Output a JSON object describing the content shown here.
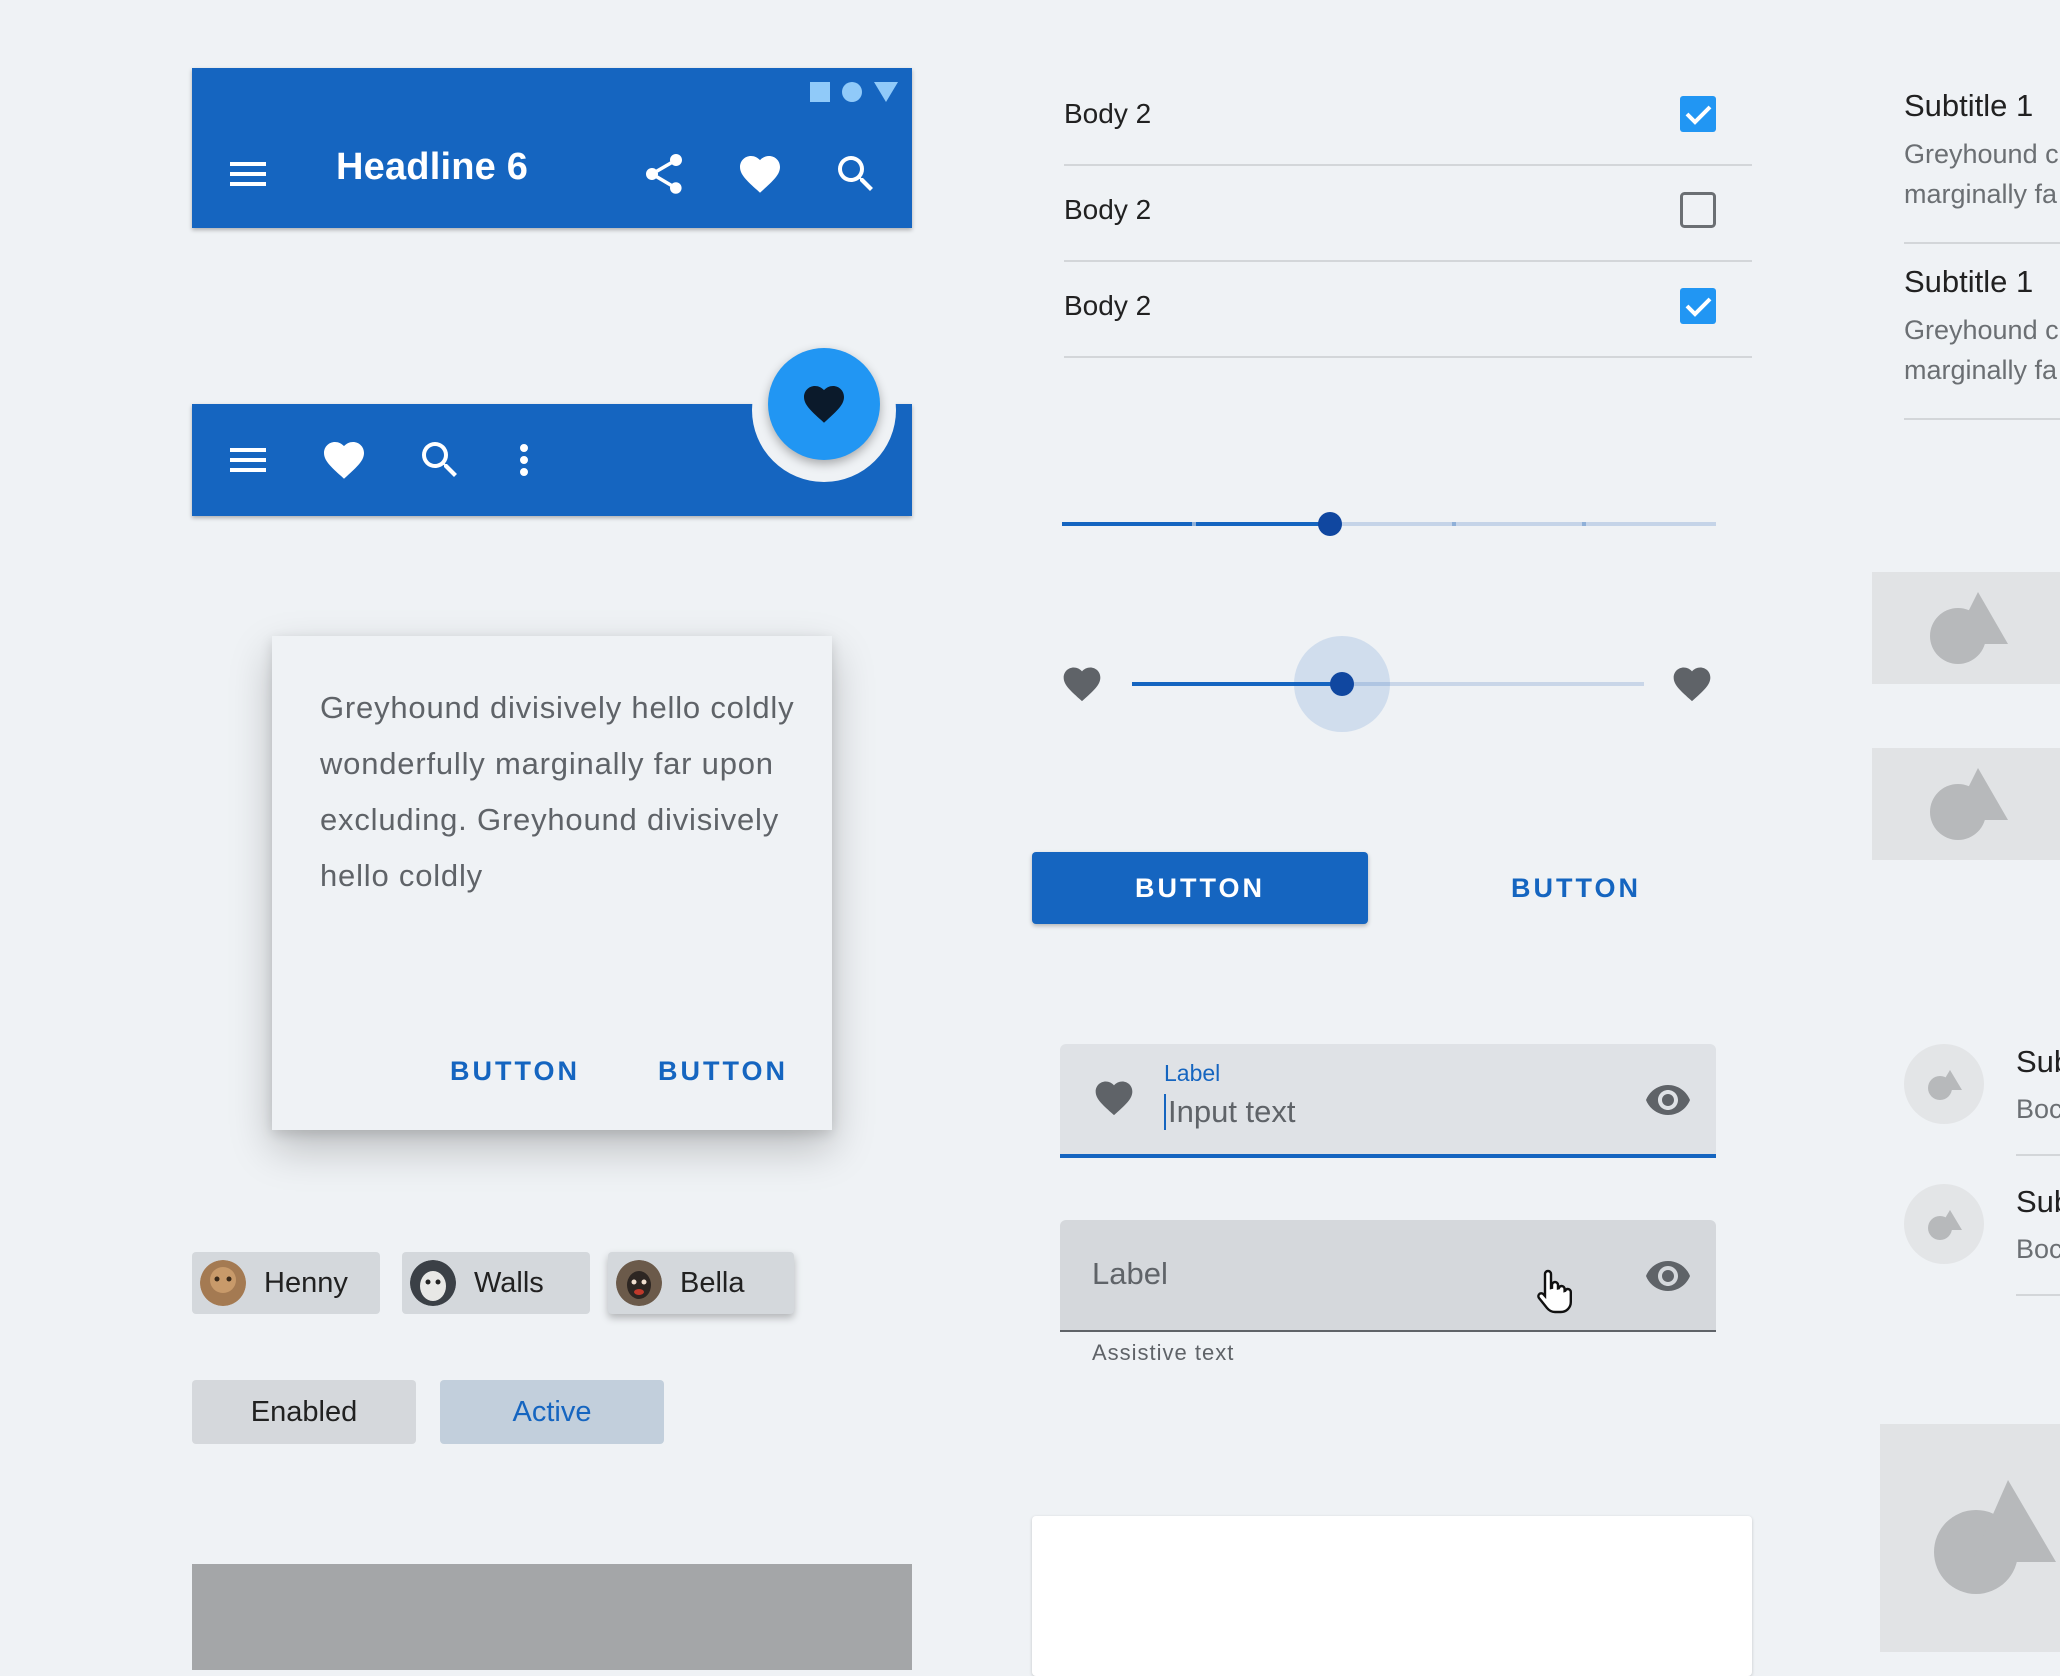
{
  "top_app_bar": {
    "title": "Headline 6",
    "status_icons": [
      "square-icon",
      "circle-icon",
      "triangle-icon"
    ],
    "actions": [
      "menu-icon",
      "share-icon",
      "favorite-icon",
      "search-icon"
    ]
  },
  "bottom_app_bar": {
    "actions": [
      "menu-icon",
      "favorite-icon",
      "search-icon",
      "more-vert-icon"
    ],
    "fab_icon": "favorite-icon"
  },
  "dialog": {
    "text": "Greyhound divisively hello coldly wonderfully marginally far upon excluding. Greyhound divisively hello coldly",
    "button_1": "BUTTON",
    "button_2": "BUTTON"
  },
  "chips": [
    {
      "label": "Henny"
    },
    {
      "label": "Walls"
    },
    {
      "label": "Bella"
    }
  ],
  "filter_chips": [
    {
      "label": "Enabled",
      "state": "enabled"
    },
    {
      "label": "Active",
      "state": "active"
    }
  ],
  "checkbox_list": [
    {
      "label": "Body 2",
      "checked": true
    },
    {
      "label": "Body 2",
      "checked": false
    },
    {
      "label": "Body 2",
      "checked": true
    }
  ],
  "discrete_slider": {
    "value": 0.41,
    "steps": 5
  },
  "continuous_slider": {
    "value": 0.41,
    "start_icon": "favorite-icon",
    "end_icon": "favorite-icon"
  },
  "buttons": {
    "contained": "BUTTON",
    "text": "BUTTON"
  },
  "text_field_focused": {
    "label": "Label",
    "value": "Input text",
    "leading_icon": "favorite-icon",
    "trailing_icon": "visibility-icon"
  },
  "text_field_hover": {
    "label": "Label",
    "assistive_text": "Assistive text",
    "trailing_icon": "visibility-icon"
  },
  "right_list": [
    {
      "title": "Subtitle 1",
      "line1": "Greyhound c",
      "line2": "marginally fa"
    },
    {
      "title": "Subtitle 1",
      "line1": "Greyhound c",
      "line2": "marginally fa"
    }
  ],
  "right_avatar_list": [
    {
      "title": "Sub",
      "body": "Boc"
    },
    {
      "title": "Sub",
      "body": "Boc"
    }
  ],
  "colors": {
    "primary": "#1565c0",
    "fab": "#2196f3",
    "checkbox": "#2196f3",
    "background": "#eff2f5"
  }
}
